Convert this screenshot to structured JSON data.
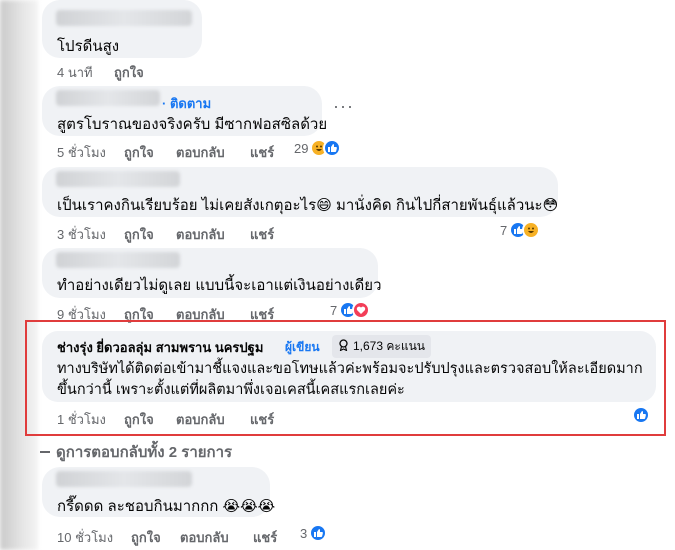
{
  "comments": [
    {
      "text": "โปรดีนสูง",
      "time": "4 นาที",
      "like": "ถูกใจ"
    },
    {
      "follow": "· ติดตาม",
      "text": "สูตรโบราณของจริงครับ มีซากฟอสซิลด้วย",
      "time": "5 ชั่วโมง",
      "like": "ถูกใจ",
      "reply": "ตอบกลับ",
      "share": "แชร์",
      "reactions": "29"
    },
    {
      "text": "เป็นเราคงกินเรียบร้อย ไม่เคยสังเกตุอะไร😄 มานั่งคิด กินไปกี่สายพันธุ์แล้วนะ😳",
      "time": "3 ชั่วโมง",
      "like": "ถูกใจ",
      "reply": "ตอบกลับ",
      "share": "แชร์",
      "reactions": "7"
    },
    {
      "text": "ทำอย่างเดียวไม่ดูเลย แบบนี้จะเอาแต่เงินอย่างเดียว",
      "time": "9 ชั่วโมง",
      "like": "ถูกใจ",
      "reply": "ตอบกลับ",
      "share": "แชร์",
      "reactions": "7"
    }
  ],
  "author_comment": {
    "name": "ช่างรุ่ง ยี่ดวอลลุ่ม สามพราน นครปฐม",
    "badge": "ผู้เขียน",
    "points": "1,673 คะแนน",
    "line1": "ทางบริษัทได้ติดต่อเข้ามาชี้แจงและขอโทษแล้วค่ะพร้อมจะปรับปรุงและตรวจสอบให้ละเอียดมาก",
    "line2": "ขึ้นกว่านี้ เพราะตั้งแต่ที่ผลิตมาพึ่งเจอเคสนี้เคสแรกเลยค่ะ",
    "time": "1 ชั่วโมง",
    "like": "ถูกใจ",
    "reply": "ตอบกลับ",
    "share": "แชร์"
  },
  "view_replies": "ดูการตอบกลับทั้ง 2 รายการ",
  "reply_comment": {
    "text": "กรี๊ดดด ละชอบกินมากกก 😭😭😭",
    "time": "10 ชั่วโมง",
    "like": "ถูกใจ",
    "reply": "ตอบกลับ",
    "share": "แชร์",
    "reactions": "3"
  },
  "colors": {
    "accent": "#1877f2",
    "highlight": "#e03c3c",
    "bubble": "#f0f2f5"
  }
}
